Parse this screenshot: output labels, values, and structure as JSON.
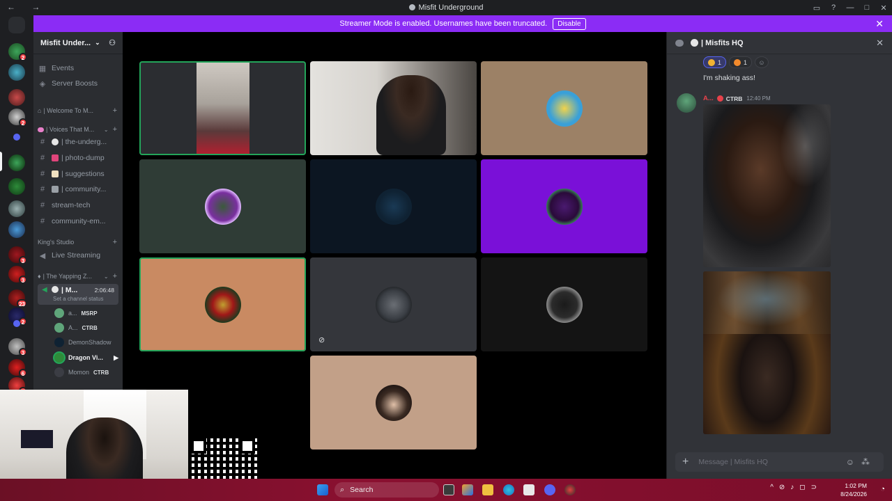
{
  "window": {
    "title": "Misfit Underground",
    "nav": "← →"
  },
  "banner": {
    "text": "Streamer Mode is enabled. Usernames have been truncated.",
    "disable_label": "Disable",
    "close": "✕"
  },
  "server_badges": [
    "2",
    "2",
    "3",
    "3",
    "23",
    "2",
    "3",
    "6",
    "3"
  ],
  "sidebar": {
    "guild_name": "Misfit Under...",
    "items": [
      {
        "label": "Events",
        "icon": "calendar-icon"
      },
      {
        "label": "Server Boosts",
        "icon": "boost-icon"
      }
    ],
    "categories": {
      "welcome": "| Welcome To M...",
      "voices": "| Voices That M...",
      "kings": "King's Studio",
      "yapping": "| The Yapping Z..."
    },
    "channels": [
      {
        "label": "| the-underg...",
        "icon": "hash-icon"
      },
      {
        "label": "| photo-dump",
        "icon": "hash-icon"
      },
      {
        "label": "| suggestions",
        "icon": "hash-icon"
      },
      {
        "label": "| community...",
        "icon": "hash-icon"
      },
      {
        "label": "stream-tech",
        "icon": "hash-icon"
      },
      {
        "label": "community-em...",
        "icon": "hash-icon"
      }
    ],
    "live_streaming": "Live Streaming",
    "voice_channel": {
      "name": "| M...",
      "elapsed": "2:06:48",
      "status": "Set a channel status"
    },
    "voice_users": [
      {
        "name": "a...",
        "tag": "MSRP"
      },
      {
        "name": "A...",
        "tag": "CTRB"
      },
      {
        "name": "DemonShadow",
        "tag": ""
      },
      {
        "name": "Dragon Vi...",
        "tag": ""
      },
      {
        "name": "Momon",
        "tag": "CTRB"
      }
    ]
  },
  "stage": {
    "tiles": [
      {
        "kind": "video",
        "bg": "#2b2d31",
        "speaking": true
      },
      {
        "kind": "video",
        "bg": "#d8d6d2",
        "speaking": false
      },
      {
        "kind": "avatar",
        "bg": "#9c8166",
        "avatar": "#3aa0d8"
      },
      {
        "kind": "avatar",
        "bg": "#2f3c36",
        "avatar": "#7a2fa0"
      },
      {
        "kind": "avatar",
        "bg": "#0c1622",
        "avatar": "#0f2233"
      },
      {
        "kind": "avatar",
        "bg": "#7a10d8",
        "avatar": "#3b1558"
      },
      {
        "kind": "avatar",
        "bg": "#c98a62",
        "avatar": "#1e3a1e",
        "speaking": true
      },
      {
        "kind": "avatar",
        "bg": "#34363b",
        "avatar": "#4a5058",
        "muted": true
      },
      {
        "kind": "avatar",
        "bg": "#141414",
        "avatar": "#2c2c2c"
      },
      {
        "kind": "avatar",
        "bg": "#c2a088",
        "avatar": "#3a2a22"
      }
    ]
  },
  "chat": {
    "title": "| Misfits HQ",
    "reactions": [
      {
        "count": "1",
        "me": true,
        "color": "#f0b232"
      },
      {
        "count": "1",
        "me": false,
        "color": "#f28a2c"
      }
    ],
    "message_text": "I'm shaking ass!",
    "msg2_user": "A...",
    "msg2_tag": "CTRB",
    "msg2_time": "12:40 PM",
    "composer_placeholder": "Message | Misfits HQ"
  },
  "taskbar": {
    "search_label": "Search",
    "time": "1:02 PM",
    "date": "8/24/2026"
  },
  "colors": {
    "accent": "#8b2cf5",
    "speaking": "#23a55a",
    "badge": "#f23f43"
  }
}
